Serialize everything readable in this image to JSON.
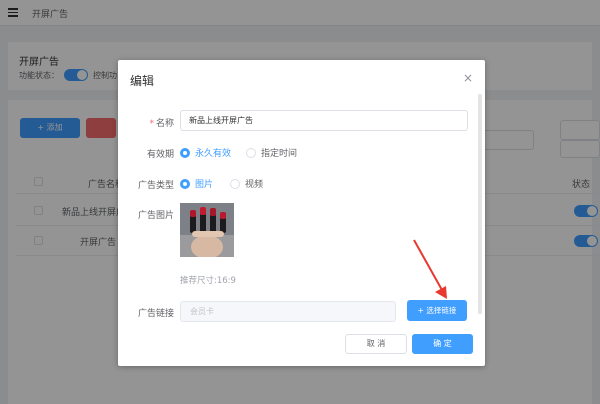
{
  "topbar": {
    "title": "开屏广告"
  },
  "section": {
    "title": "开屏广告",
    "status_label": "功能状态：",
    "desc": "控制功"
  },
  "toolbar": {
    "add_label": "+ 添加"
  },
  "table": {
    "headers": {
      "name": "广告名称",
      "status": "状态"
    },
    "rows": [
      {
        "name": "新品上线开屏广"
      },
      {
        "name": "开屏广告"
      }
    ]
  },
  "dialog": {
    "title": "编辑",
    "close_icon": "×",
    "name": {
      "label": "名称",
      "required_mark": "*",
      "value": "新品上线开屏广告"
    },
    "validity": {
      "label": "有效期",
      "options": [
        "永久有效",
        "指定时间"
      ],
      "selected": 0
    },
    "ad_type": {
      "label": "广告类型",
      "options": [
        "图片",
        "视频"
      ],
      "selected": 0
    },
    "ad_image": {
      "label": "广告图片",
      "hint": "推荐尺寸:16:9"
    },
    "ad_link": {
      "label": "广告链接",
      "placeholder": "会员卡",
      "button": "+ 选择链接"
    },
    "cancel": "取 消",
    "confirm": "确 定"
  },
  "colors": {
    "primary": "#409eff",
    "danger": "#f56c6c",
    "arrow": "#e8382f"
  }
}
